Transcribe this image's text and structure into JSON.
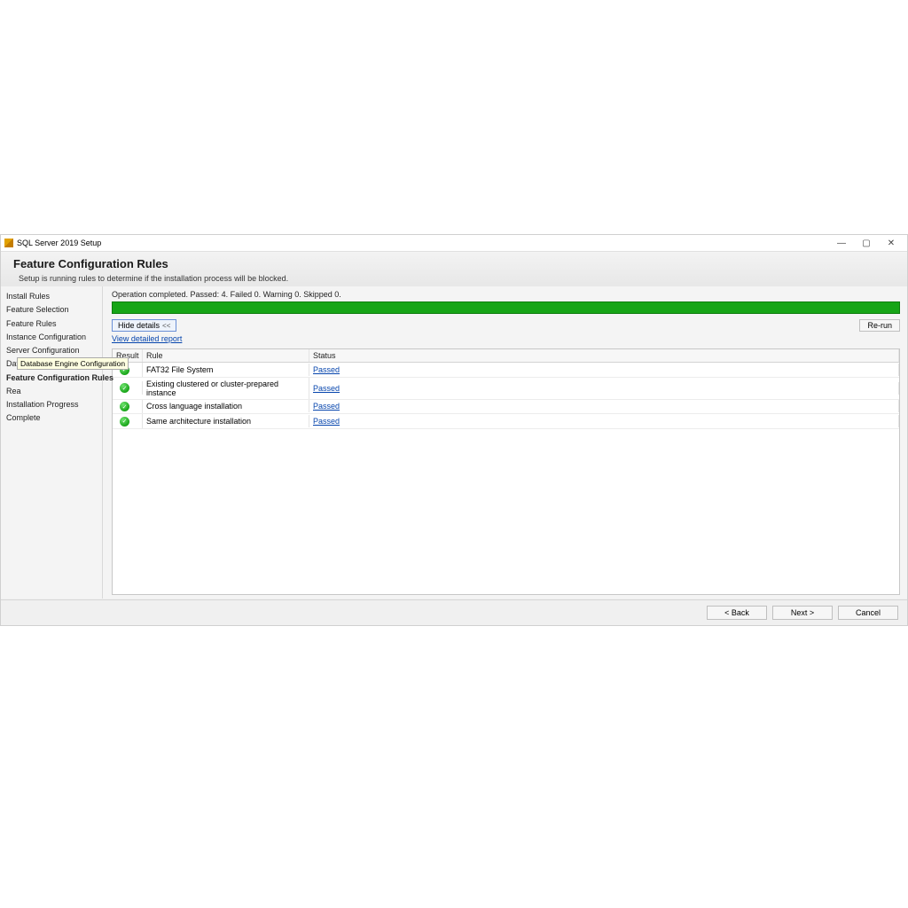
{
  "window": {
    "title": "SQL Server 2019 Setup"
  },
  "header": {
    "title": "Feature Configuration Rules",
    "subtitle": "Setup is running rules to determine if the installation process will be blocked."
  },
  "sidebar": {
    "steps": [
      {
        "label": "Install Rules",
        "active": false
      },
      {
        "label": "Feature Selection",
        "active": false
      },
      {
        "label": "Feature Rules",
        "active": false
      },
      {
        "label": "Instance Configuration",
        "active": false
      },
      {
        "label": "Server Configuration",
        "active": false
      },
      {
        "label": "Database Engine Configuration",
        "active": false
      },
      {
        "label": "Feature Configuration Rules",
        "active": true
      },
      {
        "label": "Rea",
        "active": false
      },
      {
        "label": "Installation Progress",
        "active": false
      },
      {
        "label": "Complete",
        "active": false
      }
    ],
    "tooltip": "Database Engine Configuration"
  },
  "main": {
    "status_line": "Operation completed. Passed: 4.   Failed 0.   Warning 0.   Skipped 0.",
    "hide_details_label": "Hide details",
    "rerun_label": "Re-run",
    "report_link": "View detailed report",
    "columns": {
      "result": "Result",
      "rule": "Rule",
      "status": "Status"
    },
    "rules": [
      {
        "rule": "FAT32 File System",
        "status": "Passed"
      },
      {
        "rule": "Existing clustered or cluster-prepared instance",
        "status": "Passed"
      },
      {
        "rule": "Cross language installation",
        "status": "Passed"
      },
      {
        "rule": "Same architecture installation",
        "status": "Passed"
      }
    ]
  },
  "footer": {
    "back": "< Back",
    "next": "Next >",
    "cancel": "Cancel"
  }
}
